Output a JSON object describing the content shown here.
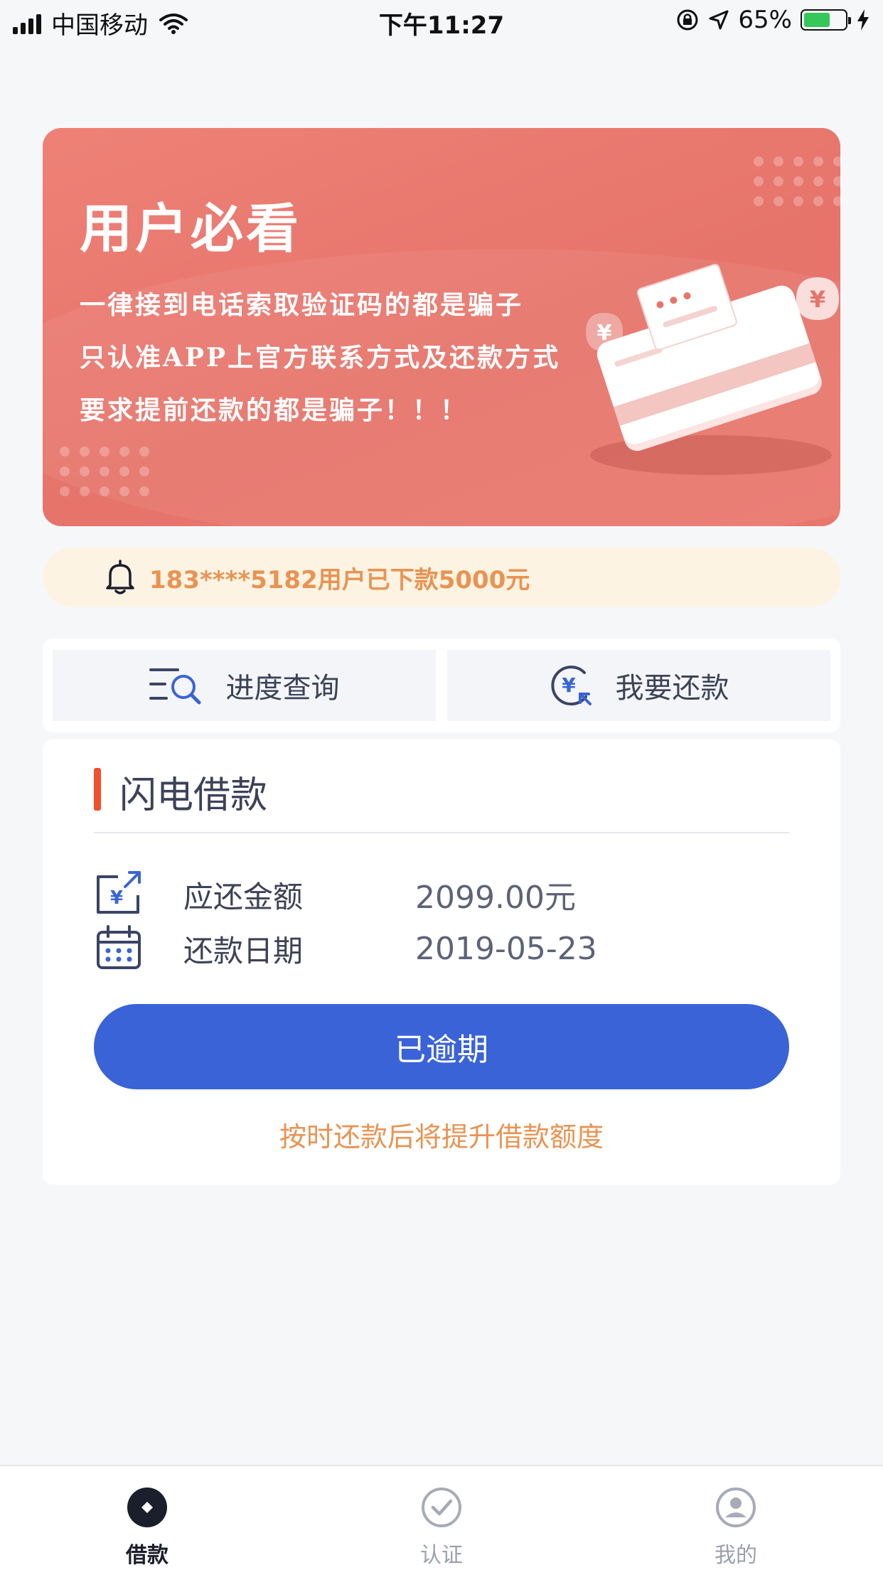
{
  "status_bar": {
    "carrier": "中国移动",
    "time": "下午11:27",
    "battery": "65%",
    "battery_level": 0.65
  },
  "banner": {
    "title": "用户必看",
    "lines": [
      "一律接到电话索取验证码的都是骗子",
      "只认准APP上官方联系方式及还款方式",
      "要求提前还款的都是骗子！！！"
    ],
    "currency_symbol": "¥"
  },
  "notice": {
    "text": "183****5182用户已下款5000元"
  },
  "actions": [
    {
      "label": "进度查询",
      "icon": "search-list-icon"
    },
    {
      "label": "我要还款",
      "icon": "yuan-repay-icon"
    }
  ],
  "loan": {
    "title": "闪电借款",
    "amount_label": "应还金额",
    "amount_value": "2099.00元",
    "date_label": "还款日期",
    "date_value": "2019-05-23",
    "button_label": "已逾期",
    "hint": "按时还款后将提升借款额度",
    "amount_icon_symbol": "¥"
  },
  "tabbar": [
    {
      "label": "借款",
      "icon": "loan-icon",
      "active": true
    },
    {
      "label": "认证",
      "icon": "check-circle-icon",
      "active": false
    },
    {
      "label": "我的",
      "icon": "profile-icon",
      "active": false
    }
  ],
  "colors": {
    "primary": "#3a63d8",
    "accent_orange": "#e99352",
    "banner_red": "#e6746b",
    "title_bar_red": "#f14f2e"
  }
}
